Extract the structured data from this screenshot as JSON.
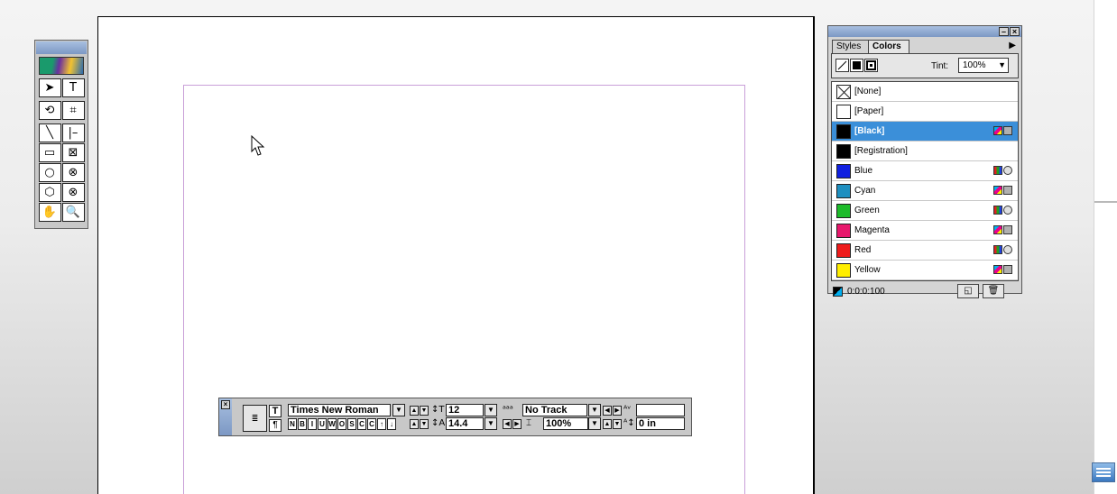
{
  "toolbox": {
    "tools": [
      {
        "name": "selection-tool",
        "glyph": "➤"
      },
      {
        "name": "type-tool",
        "glyph": "T"
      },
      {
        "name": "rotate-tool",
        "glyph": "⟲"
      },
      {
        "name": "crop-tool",
        "glyph": "⌗"
      },
      {
        "name": "line-tool",
        "glyph": "╲"
      },
      {
        "name": "orthogonal-line-tool",
        "glyph": "|–"
      },
      {
        "name": "rectangle-tool",
        "glyph": "▭"
      },
      {
        "name": "rectangle-frame-tool",
        "glyph": "⊠"
      },
      {
        "name": "ellipse-tool",
        "glyph": "○"
      },
      {
        "name": "ellipse-frame-tool",
        "glyph": "⊗"
      },
      {
        "name": "polygon-tool",
        "glyph": "⬡"
      },
      {
        "name": "polygon-frame-tool",
        "glyph": "⊗"
      },
      {
        "name": "hand-tool",
        "glyph": "✋"
      },
      {
        "name": "zoom-tool",
        "glyph": "🔍"
      }
    ]
  },
  "colors_panel": {
    "tabs": [
      "Styles",
      "Colors"
    ],
    "menu_arrow": "▶",
    "tint_label": "Tint:",
    "tint_value": "100%",
    "swatches": [
      {
        "label": "[None]",
        "color": "#ffffff",
        "kind": "none",
        "mode": ""
      },
      {
        "label": "[Paper]",
        "color": "#ffffff",
        "kind": "plain",
        "mode": ""
      },
      {
        "label": "[Black]",
        "color": "#000000",
        "kind": "plain",
        "mode": "process-square",
        "selected": true
      },
      {
        "label": "[Registration]",
        "color": "#000000",
        "kind": "plain",
        "mode": ""
      },
      {
        "label": "Blue",
        "color": "#1020e0",
        "kind": "plain",
        "mode": "rgb-circle"
      },
      {
        "label": "Cyan",
        "color": "#1e8fc0",
        "kind": "plain",
        "mode": "process-square"
      },
      {
        "label": "Green",
        "color": "#1dbb2a",
        "kind": "plain",
        "mode": "rgb-circle"
      },
      {
        "label": "Magenta",
        "color": "#e8186c",
        "kind": "plain",
        "mode": "process-square"
      },
      {
        "label": "Red",
        "color": "#ee1b1b",
        "kind": "plain",
        "mode": "rgb-circle"
      },
      {
        "label": "Yellow",
        "color": "#ffee00",
        "kind": "plain",
        "mode": "process-square"
      }
    ],
    "footer_value": "0:0:0:100",
    "new_swatch_glyph": "◱",
    "delete_glyph": "🗑"
  },
  "char_palette": {
    "font_name": "Times New Roman",
    "font_size": "12",
    "leading": "14.4",
    "tracking": "No Track",
    "horizontal_scale": "100%",
    "baseline_shift": "0 in",
    "kerning": "",
    "type_styles": [
      "N",
      "B",
      "I",
      "U",
      "W",
      "O",
      "S",
      "C",
      "C",
      "↑",
      "↓"
    ]
  }
}
